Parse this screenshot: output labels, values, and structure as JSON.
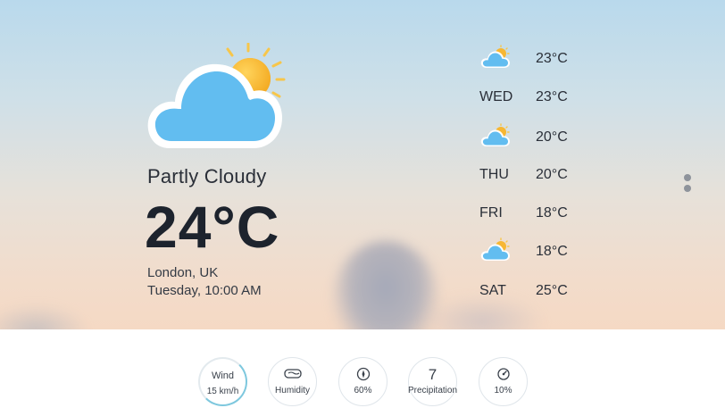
{
  "current": {
    "condition": "Partly Cloudy",
    "temperature": "24°C",
    "location": "London, UK",
    "datetime": "Tuesday, 10:00 AM",
    "icon": "partly-cloudy-icon"
  },
  "forecast": [
    {
      "day": "",
      "temp": "23°C",
      "icon": "partly-cloudy-icon"
    },
    {
      "day": "WED",
      "temp": "23°C",
      "icon": ""
    },
    {
      "day": "",
      "temp": "20°C",
      "icon": "partly-cloudy-icon"
    },
    {
      "day": "THU",
      "temp": "20°C",
      "icon": ""
    },
    {
      "day": "FRI",
      "temp": "18°C",
      "icon": ""
    },
    {
      "day": "",
      "temp": "18°C",
      "icon": "partly-cloudy-icon"
    },
    {
      "day": "SAT",
      "temp": "25°C",
      "icon": ""
    }
  ],
  "metrics": [
    {
      "title": "Wind",
      "value": "15 km/h",
      "icon": "",
      "active": true
    },
    {
      "title": "",
      "value": "Humidity",
      "icon": "humidity-icon"
    },
    {
      "title": "",
      "value": "60%",
      "icon": "compass-icon"
    },
    {
      "title": "7",
      "value": "Precipitation",
      "icon": ""
    },
    {
      "title": "",
      "value": "10%",
      "icon": "gauge-icon"
    }
  ],
  "colors": {
    "cloud_fill": "#62bdf0",
    "cloud_outline": "#ffffff",
    "sun": "#f7b733",
    "accent_ring": "#7ec8de"
  }
}
